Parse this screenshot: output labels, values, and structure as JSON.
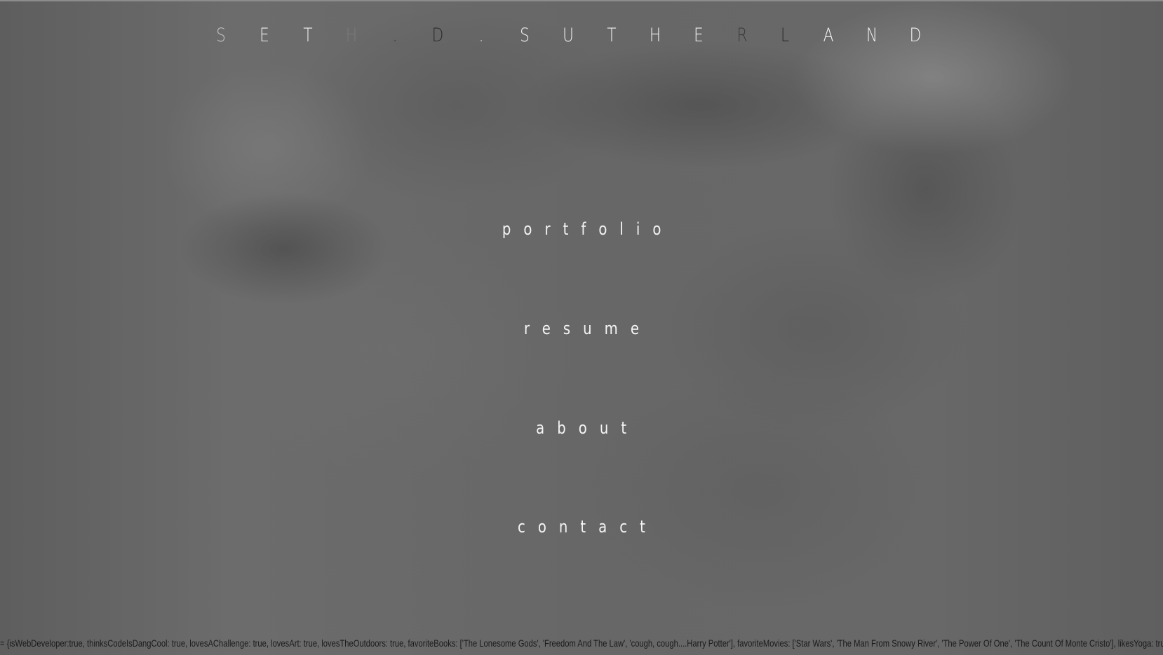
{
  "header": {
    "letters": [
      {
        "char": "S",
        "color": "#c4c4c4"
      },
      {
        "char": "E",
        "color": "#f2f2f2"
      },
      {
        "char": "T",
        "color": "#f2f2f2"
      },
      {
        "char": "H",
        "color": "#7a7a7a"
      },
      {
        "char": ".",
        "color": "#2a2a2a"
      },
      {
        "char": "D",
        "color": "#2a2a2a"
      },
      {
        "char": ".",
        "color": "#f2f2f2"
      },
      {
        "char": "S",
        "color": "#f2f2f2"
      },
      {
        "char": "U",
        "color": "#f2f2f2"
      },
      {
        "char": "T",
        "color": "#f2f2f2"
      },
      {
        "char": "H",
        "color": "#f2f2f2"
      },
      {
        "char": "E",
        "color": "#f2f2f2"
      },
      {
        "char": "R",
        "color": "#3c3c3c"
      },
      {
        "char": "L",
        "color": "#2a2a2a"
      },
      {
        "char": "A",
        "color": "#f2f2f2"
      },
      {
        "char": "N",
        "color": "#f2f2f2"
      },
      {
        "char": "D",
        "color": "#f2f2f2"
      }
    ]
  },
  "nav": {
    "portfolio": "portfolio",
    "resume": "resume",
    "about": "about",
    "contact": "contact"
  },
  "ticker": {
    "text": "= {isWebDeveloper:true, thinksCodeIsDangCool: true, lovesAChallenge: true, lovesArt: true, lovesTheOutdoors: true, favoriteBooks: ['The Lonesome Gods', 'Freedom And The Law', 'cough, cough....Harry Potter'], favoriteMovies: ['Star Wars', 'The Man From Snowy River', 'The Power Of One', 'The Count Of Monte Cristo'], likesYoga: true, likesRoc"
  },
  "colors": {
    "background": "#6a6a6a",
    "nav_text": "#f4f4f4",
    "ticker_text": "#1a1a1a"
  }
}
